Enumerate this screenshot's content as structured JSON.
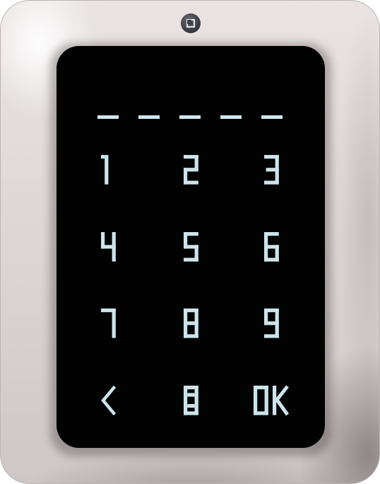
{
  "pin_display": {
    "slots": 5
  },
  "keypad": {
    "keys": [
      "1",
      "2",
      "3",
      "4",
      "5",
      "6",
      "7",
      "8",
      "9",
      "<",
      "0",
      "OK"
    ],
    "key_color": "#cde4ec"
  },
  "device": {
    "sensor_icon": "lock-indicator-icon",
    "screen_color": "#020202",
    "housing_color": "#e3dcdc"
  }
}
